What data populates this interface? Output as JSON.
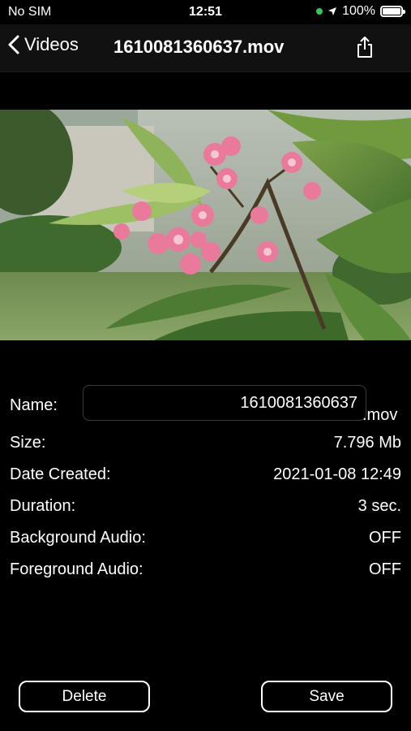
{
  "status": {
    "carrier": "No SIM",
    "time": "12:51",
    "battery": "100%",
    "battery_level": 1.0
  },
  "nav": {
    "back_label": "Videos",
    "title": "1610081360637.mov"
  },
  "details": {
    "name_label": "Name:",
    "name_value": "1610081360637",
    "extension": ".mov",
    "size_label": "Size:",
    "size_value": "7.796 Mb",
    "date_label": "Date Created:",
    "date_value": "2021-01-08 12:49",
    "duration_label": "Duration:",
    "duration_value": "3 sec.",
    "bg_audio_label": "Background Audio:",
    "bg_audio_value": "OFF",
    "fg_audio_label": "Foreground Audio:",
    "fg_audio_value": "OFF"
  },
  "buttons": {
    "delete": "Delete",
    "save": "Save"
  },
  "colors": {
    "background": "#000000",
    "location_dot": "#34c759"
  }
}
